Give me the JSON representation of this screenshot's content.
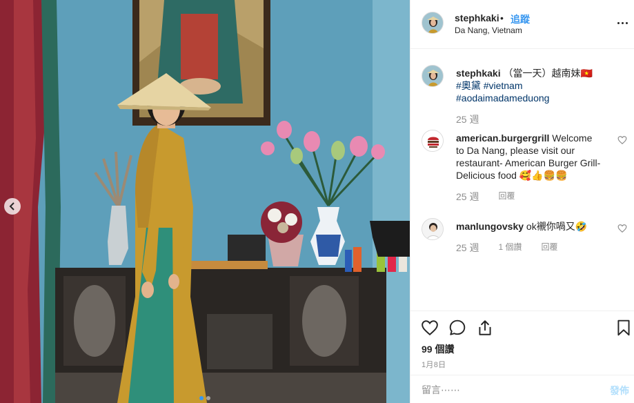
{
  "post": {
    "username": "stephkaki",
    "separator": "•",
    "follow_label": "追蹤",
    "location": "Da Nang, Vietnam"
  },
  "caption": {
    "username": "stephkaki",
    "text": "（當一天）越南妹",
    "flag": "🇻🇳",
    "hashtags": [
      "#奧黛",
      "#vietnam",
      "#aodaimadameduong"
    ],
    "time": "25 週"
  },
  "comments": [
    {
      "username": "american.burgergrill",
      "text": "Welcome to Da Nang, please visit our restaurant- American Burger Grill- Delicious food 🥰👍🍔🍔",
      "time": "25 週",
      "likes": "",
      "reply_label": "回覆",
      "avatar_label": "AMERICAN BURGER GRILL"
    },
    {
      "username": "manlungovsky",
      "text": "ok襯你喎又🤣",
      "time": "25 週",
      "likes": "1 個讚",
      "reply_label": "回覆"
    }
  ],
  "actions": {
    "icons": [
      "heart-icon",
      "comment-icon",
      "share-icon",
      "bookmark-icon"
    ]
  },
  "likes_text": "99 個讚",
  "date_text": "1月8日",
  "comment_box": {
    "placeholder": "留言⋯⋯",
    "post_label": "發佈"
  },
  "carousel": {
    "dots": 2,
    "active_index": 0
  },
  "colors": {
    "link_blue": "#3897f0",
    "hashtag_blue": "#003569",
    "muted_gray": "#8e8e8e",
    "post_button_disabled": "#b2dffc"
  }
}
